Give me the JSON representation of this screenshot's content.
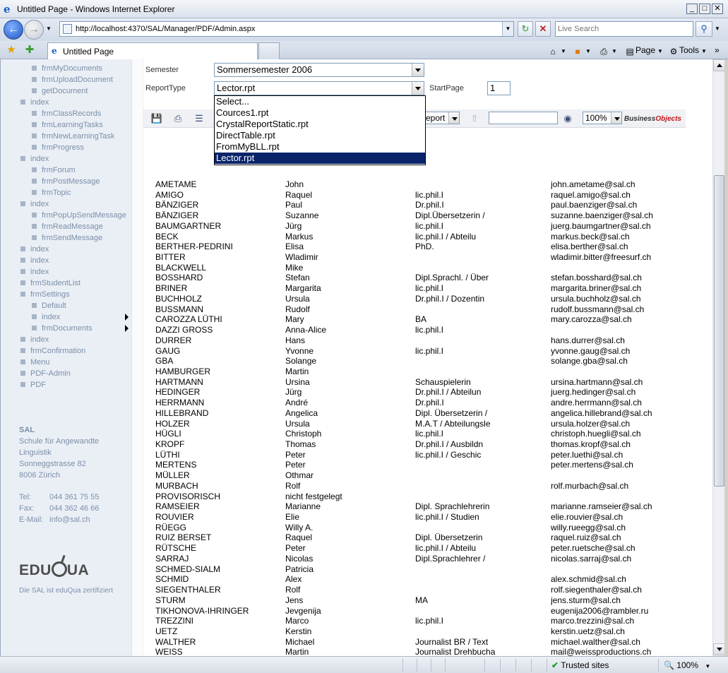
{
  "window": {
    "title": "Untitled Page - Windows Internet Explorer",
    "minimize": "_",
    "maximize": "□",
    "close": "✕"
  },
  "address": {
    "url": "http://localhost:4370/SAL/Manager/PDF/Admin.aspx",
    "search_placeholder": "Live Search"
  },
  "tabs": {
    "active_label": "Untitled Page"
  },
  "commands": {
    "page": "Page",
    "tools": "Tools"
  },
  "sidebar": {
    "items": [
      {
        "label": "frmMyDocuments",
        "level": 2
      },
      {
        "label": "frmUploadDocument",
        "level": 2
      },
      {
        "label": "getDocument",
        "level": 2
      },
      {
        "label": "index",
        "level": 1
      },
      {
        "label": "frmClassRecords",
        "level": 2
      },
      {
        "label": "frmLearningTasks",
        "level": 2
      },
      {
        "label": "frmNewLearningTask",
        "level": 2
      },
      {
        "label": "frmProgress",
        "level": 2
      },
      {
        "label": "index",
        "level": 1
      },
      {
        "label": "frmForum",
        "level": 2
      },
      {
        "label": "frmPostMessage",
        "level": 2
      },
      {
        "label": "frmTopic",
        "level": 2
      },
      {
        "label": "index",
        "level": 1
      },
      {
        "label": "frmPopUpSendMessage",
        "level": 2
      },
      {
        "label": "frmReadMessage",
        "level": 2
      },
      {
        "label": "frmSendMessage",
        "level": 2
      },
      {
        "label": "index",
        "level": 1
      },
      {
        "label": "index",
        "level": 1
      },
      {
        "label": "index",
        "level": 1
      },
      {
        "label": "frmStudentList",
        "level": 1
      },
      {
        "label": "frmSettings",
        "level": 1
      },
      {
        "label": "Default",
        "level": 2
      },
      {
        "label": "index",
        "level": 2
      },
      {
        "label": "frmDocuments",
        "level": 2
      },
      {
        "label": "index",
        "level": 1
      },
      {
        "label": "frmConfirmation",
        "level": 1
      },
      {
        "label": "Menu",
        "level": 1
      },
      {
        "label": "PDF-Admin",
        "level": 1
      },
      {
        "label": "PDF",
        "level": 1
      }
    ],
    "contact": {
      "org_short": "SAL",
      "org_line1": "Schule für Angewandte",
      "org_line2": "Linguistik",
      "street": "Sonneggstrasse 82",
      "city": "8006 Zürich",
      "tel_label": "Tel:",
      "tel": "044 361 75 55",
      "fax_label": "Fax:",
      "fax": "044 362 46 66",
      "email_label": "E-Mail:",
      "email": "info@sal.ch"
    },
    "logo_text_left": "EDU",
    "logo_text_right": "UA",
    "certified": "Die SAL ist eduQua zertifiziert"
  },
  "form": {
    "semester_label": "Semester",
    "semester_value": "Sommersemester 2006",
    "reporttype_label": "ReportType",
    "reporttype_value": "Lector.rpt",
    "startpage_label": "StartPage",
    "startpage_value": "1",
    "reporttype_options": [
      "Select...",
      "Cources1.rpt",
      "CrystalReportStatic.rpt",
      "DirectTable.rpt",
      "FromMyBLL.rpt",
      "Lector.rpt"
    ],
    "reporttype_selected_index": 5
  },
  "crystal_toolbar": {
    "group_select": "eport",
    "zoom": "100%",
    "brand_left": "Business",
    "brand_right": "Objects"
  },
  "report_rows": [
    [
      "AMETAME",
      "John",
      "",
      "john.ametame@sal.ch"
    ],
    [
      "AMIGO",
      "Raquel",
      "lic.phil.I",
      "raquel.amigo@sal.ch"
    ],
    [
      "BÄNZIGER",
      "Paul",
      "Dr.phil.I",
      "paul.baenziger@sal.ch"
    ],
    [
      "BÄNZIGER",
      "Suzanne",
      "Dipl.Übersetzerin /",
      "suzanne.baenziger@sal.ch"
    ],
    [
      "BAUMGARTNER",
      "Jürg",
      "lic.phil.I",
      "juerg.baumgartner@sal.ch"
    ],
    [
      "BECK",
      "Markus",
      "lic.phil.I / Abteilu",
      "markus.beck@sal.ch"
    ],
    [
      "BERTHER-PEDRINI",
      "Elisa",
      "PhD.",
      "elisa.berther@sal.ch"
    ],
    [
      "BITTER",
      "Wladimir",
      "",
      "wladimir.bitter@freesurf.ch"
    ],
    [
      "BLACKWELL",
      "Mike",
      "",
      ""
    ],
    [
      "BOSSHARD",
      "Stefan",
      "Dipl.Sprachl. / Über",
      "stefan.bosshard@sal.ch"
    ],
    [
      "BRINER",
      "Margarita",
      "lic.phil.I",
      "margarita.briner@sal.ch"
    ],
    [
      "BUCHHOLZ",
      "Ursula",
      "Dr.phil.I / Dozentin",
      "ursula.buchholz@sal.ch"
    ],
    [
      "BUSSMANN",
      "Rudolf",
      "",
      "rudolf.bussmann@sal.ch"
    ],
    [
      "CAROZZA LÜTHI",
      "Mary",
      "BA",
      "mary.carozza@sal.ch"
    ],
    [
      "DAZZI GROSS",
      "Anna-Alice",
      "lic.phil.I",
      ""
    ],
    [
      "DURRER",
      "Hans",
      "",
      "hans.durrer@sal.ch"
    ],
    [
      "GAUG",
      "Yvonne",
      "lic.phil.I",
      "yvonne.gaug@sal.ch"
    ],
    [
      "GBA",
      "Solange",
      "",
      "solange.gba@sal.ch"
    ],
    [
      "HAMBURGER",
      "Martin",
      "",
      ""
    ],
    [
      "HARTMANN",
      "Ursina",
      "Schauspielerin",
      "ursina.hartmann@sal.ch"
    ],
    [
      "HEDINGER",
      "Jürg",
      "Dr.phil.I / Abteilun",
      "juerg.hedinger@sal.ch"
    ],
    [
      "HERRMANN",
      "André",
      "Dr.phil.I",
      "andre.herrmann@sal.ch"
    ],
    [
      "HILLEBRAND",
      "Angelica",
      "Dipl. Übersetzerin /",
      "angelica.hillebrand@sal.ch"
    ],
    [
      "HOLZER",
      "Ursula",
      "M.A.T / Abteilungsle",
      "ursula.holzer@sal.ch"
    ],
    [
      "HÜGLI",
      "Christoph",
      "lic.phil.I",
      "christoph.huegli@sal.ch"
    ],
    [
      "KROPF",
      "Thomas",
      "Dr.phil.I / Ausbildn",
      "thomas.kropf@sal.ch"
    ],
    [
      "LÜTHI",
      "Peter",
      "lic.phil.I / Geschic",
      "peter.luethi@sal.ch"
    ],
    [
      "MERTENS",
      "Peter",
      "",
      "peter.mertens@sal.ch"
    ],
    [
      "MÜLLER",
      "Othmar",
      "",
      ""
    ],
    [
      "MURBACH",
      "Rolf",
      "",
      "rolf.murbach@sal.ch"
    ],
    [
      "PROVISORISCH",
      "nicht festgelegt",
      "",
      ""
    ],
    [
      "RAMSEIER",
      "Marianne",
      "Dipl. Sprachlehrerin",
      "marianne.ramseier@sal.ch"
    ],
    [
      "ROUVIER",
      "Elie",
      "lic.phil.I / Studien",
      "elie.rouvier@sal.ch"
    ],
    [
      "RÜEGG",
      "Willy A.",
      "",
      "willy.rueegg@sal.ch"
    ],
    [
      "RUIZ BERSET",
      "Raquel",
      "Dipl. Übersetzerin",
      "raquel.ruiz@sal.ch"
    ],
    [
      "RÜTSCHE",
      "Peter",
      "lic.phil.I / Abteilu",
      "peter.ruetsche@sal.ch"
    ],
    [
      "SARRAJ",
      "Nicolas",
      "Dipl.Sprachlehrer /",
      "nicolas.sarraj@sal.ch"
    ],
    [
      "SCHMED-SIALM",
      "Patricia",
      "",
      ""
    ],
    [
      "SCHMID",
      "Alex",
      "",
      "alex.schmid@sal.ch"
    ],
    [
      "SIEGENTHALER",
      "Rolf",
      "",
      "rolf.siegenthaler@sal.ch"
    ],
    [
      "STURM",
      "Jens",
      "MA",
      "jens.sturm@sal.ch"
    ],
    [
      "TIKHONOVA-IHRINGER",
      "Jevgenija",
      "",
      "eugenija2006@rambler.ru"
    ],
    [
      "TREZZINI",
      "Marco",
      "lic.phil.I",
      "marco.trezzini@sal.ch"
    ],
    [
      "UETZ",
      "Kerstin",
      "",
      "kerstin.uetz@sal.ch"
    ],
    [
      "WALTHER",
      "Michael",
      "Journalist BR / Text",
      "michael.walther@sal.ch"
    ],
    [
      "WEISS",
      "Martin",
      "Journalist Drehbucha",
      "mail@weissproductions.ch"
    ]
  ],
  "status": {
    "zone": "Trusted sites",
    "zoom": "100%"
  },
  "colors": {
    "sidebar_bg": "#eaeff6",
    "menu_text": "#7c8fa8",
    "selection": "#0a246a"
  }
}
